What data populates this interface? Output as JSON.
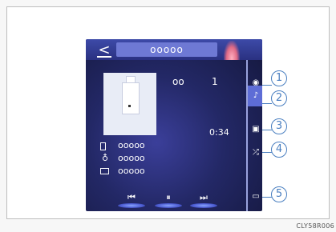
{
  "header": {
    "back_glyph": "<",
    "title": "ooooo"
  },
  "track": {
    "label": "oo",
    "number": "1",
    "elapsed": "0:34"
  },
  "info_rows": [
    {
      "icon": "file-icon",
      "text": "ooooo"
    },
    {
      "icon": "person-icon",
      "text": "ooooo"
    },
    {
      "icon": "folder-icon",
      "text": "ooooo"
    }
  ],
  "controls": [
    {
      "name": "previous-track-button",
      "glyph": "⏮"
    },
    {
      "name": "pause-button",
      "glyph": "⏸"
    },
    {
      "name": "next-track-button",
      "glyph": "⏭"
    }
  ],
  "side_buttons": [
    {
      "name": "source-icon",
      "glyph": "◉"
    },
    {
      "name": "music-note-icon",
      "glyph": "♪"
    },
    {
      "name": "picture-icon",
      "glyph": "▣"
    },
    {
      "name": "shuffle-icon",
      "glyph": "⤮"
    },
    {
      "name": "display-icon",
      "glyph": "▭"
    }
  ],
  "callouts": [
    "1",
    "2",
    "3",
    "4",
    "5"
  ],
  "figure_code": "CLY58R006"
}
